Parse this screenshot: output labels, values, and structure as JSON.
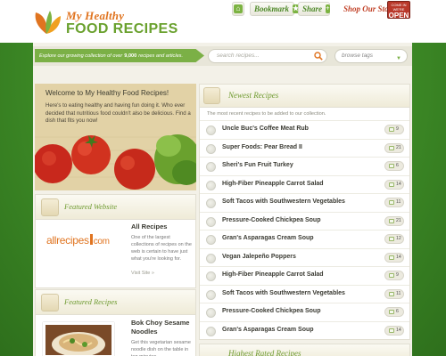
{
  "header": {
    "logo_line1": "My Healthy",
    "logo_line2": "FOOD RECIPES",
    "home_icon": "home-icon",
    "bookmark_label": "Bookmark",
    "share_label": "Share",
    "shop_label": "Shop Our Store",
    "open_sign_top": "COME IN WE'RE",
    "open_sign_main": "OPEN"
  },
  "search_strip": {
    "tagline_before": "Explore our growing collection of over",
    "tagline_count": "9,000",
    "tagline_after": "recipes and articles.",
    "search_placeholder": "search recipes...",
    "browse_label": "browse tags"
  },
  "welcome": {
    "title": "Welcome to My Healthy Food Recipes!",
    "text": "Here's to eating healthy and having fun doing it. Who ever decided that nutritious food couldn't also be delicious. Find a dish that fits you now!"
  },
  "featured_website": {
    "heading": "Featured Website",
    "logo_text_a": "allrecipes",
    "logo_text_b": "com",
    "name": "All Recipes",
    "description": "One of the largest collections of recipes on the web is certain to have just what you're looking for.",
    "link": "Visit Site »"
  },
  "featured_recipes": {
    "heading": "Featured Recipes",
    "name": "Bok Choy Sesame Noodles",
    "description": "Get this vegetarian sesame noodle dish on the table in ten minutes"
  },
  "newest_recipes": {
    "heading": "Newest Recipes",
    "subtitle": "The most recent recipes to be added to our collection.",
    "items": [
      {
        "name": "Uncle Buc's Coffee Meat Rub",
        "count": "9"
      },
      {
        "name": "Super Foods: Pear Bread II",
        "count": "21"
      },
      {
        "name": "Sheri's Fun Fruit Turkey",
        "count": "6"
      },
      {
        "name": "High-Fiber Pineapple Carrot Salad",
        "count": "14"
      },
      {
        "name": "Soft Tacos with Southwestern Vegetables",
        "count": "11"
      },
      {
        "name": "Pressure-Cooked Chickpea Soup",
        "count": "21"
      },
      {
        "name": "Gran's Asparagas Cream Soup",
        "count": "12"
      },
      {
        "name": "Vegan Jalepeño Poppers",
        "count": "14"
      },
      {
        "name": "High-Fiber Pineapple Carrot Salad",
        "count": "9"
      },
      {
        "name": "Soft Tacos with Southwestern Vegetables",
        "count": "11"
      },
      {
        "name": "Pressure-Cooked Chickpea Soup",
        "count": "6"
      },
      {
        "name": "Gran's Asparagas Cream Soup",
        "count": "14"
      }
    ]
  },
  "highest_rated": {
    "heading": "Highest Rated Recipes"
  },
  "colors": {
    "brand_green": "#6aa12e",
    "brand_orange": "#e07420",
    "background_green": "#3d8a26",
    "panel_cream": "#f3f1e8"
  }
}
